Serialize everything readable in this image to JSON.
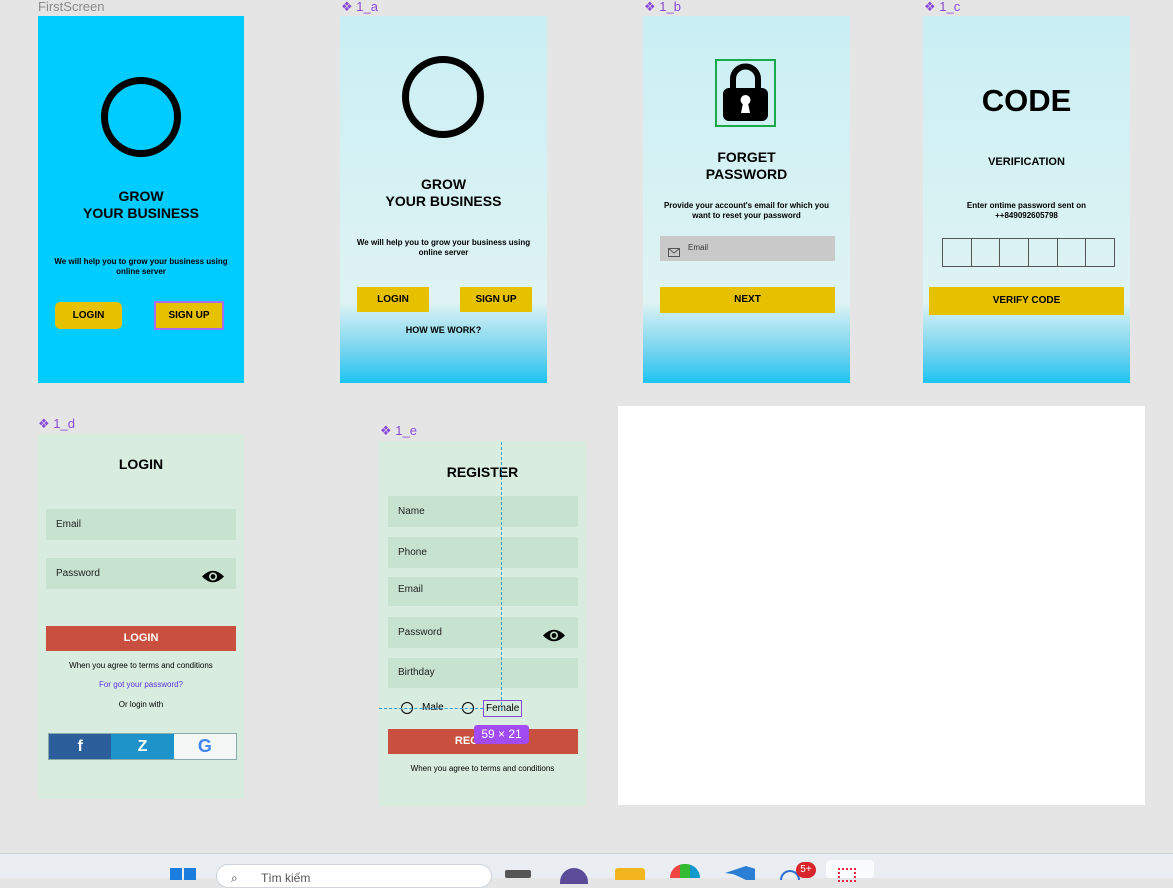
{
  "frames": {
    "first_screen": {
      "label": "FirstScreen"
    },
    "f1a": {
      "label": "1_a"
    },
    "f1b": {
      "label": "1_b"
    },
    "f1c": {
      "label": "1_c"
    },
    "f1d": {
      "label": "1_d"
    },
    "f1e": {
      "label": "1_e"
    }
  },
  "first_screen": {
    "title_line1": "GROW",
    "title_line2": "YOUR BUSINESS",
    "subtitle": "We will help you to grow your business using online server",
    "login": "LOGIN",
    "signup": "SIGN UP"
  },
  "screen_1a": {
    "title_line1": "GROW",
    "title_line2": "YOUR BUSINESS",
    "subtitle": "We will help you to grow your business using online server",
    "login": "LOGIN",
    "signup": "SIGN UP",
    "how": "HOW WE WORK?"
  },
  "screen_1b": {
    "title_line1": "FORGET",
    "title_line2": "PASSWORD",
    "desc": "Provide your account's email for which you want to reset your password",
    "email_placeholder": "Email",
    "next": "NEXT"
  },
  "screen_1c": {
    "code": "CODE",
    "verification": "VERIFICATION",
    "desc_line1": "Enter ontime password sent on",
    "desc_line2": "++849092605798",
    "verify": "VERIFY CODE"
  },
  "screen_1d": {
    "title": "LOGIN",
    "email": "Email",
    "password": "Password",
    "login": "LOGIN",
    "terms": "When you agree to terms and conditions",
    "forgot": "For got your password?",
    "or_login": "Or login with",
    "social": {
      "facebook": "f",
      "zalo": "Z",
      "google": "G"
    }
  },
  "screen_1e": {
    "title": "REGISTER",
    "name": "Name",
    "phone": "Phone",
    "email": "Email",
    "password": "Password",
    "birthday": "Birthday",
    "male": "Male",
    "female": "Female",
    "register_visible": "REGIS",
    "register_tail": "TER",
    "terms": "When you agree to terms and conditions",
    "size_badge": "59 × 21"
  },
  "taskbar": {
    "search_placeholder": "Tìm kiếm",
    "notification_badge": "5+"
  },
  "colors": {
    "cyan": "#00ccff",
    "yellow": "#e5c100",
    "red": "#c9503e",
    "light_green": "#d8ede0",
    "figma_purple": "#8a4bd8"
  }
}
